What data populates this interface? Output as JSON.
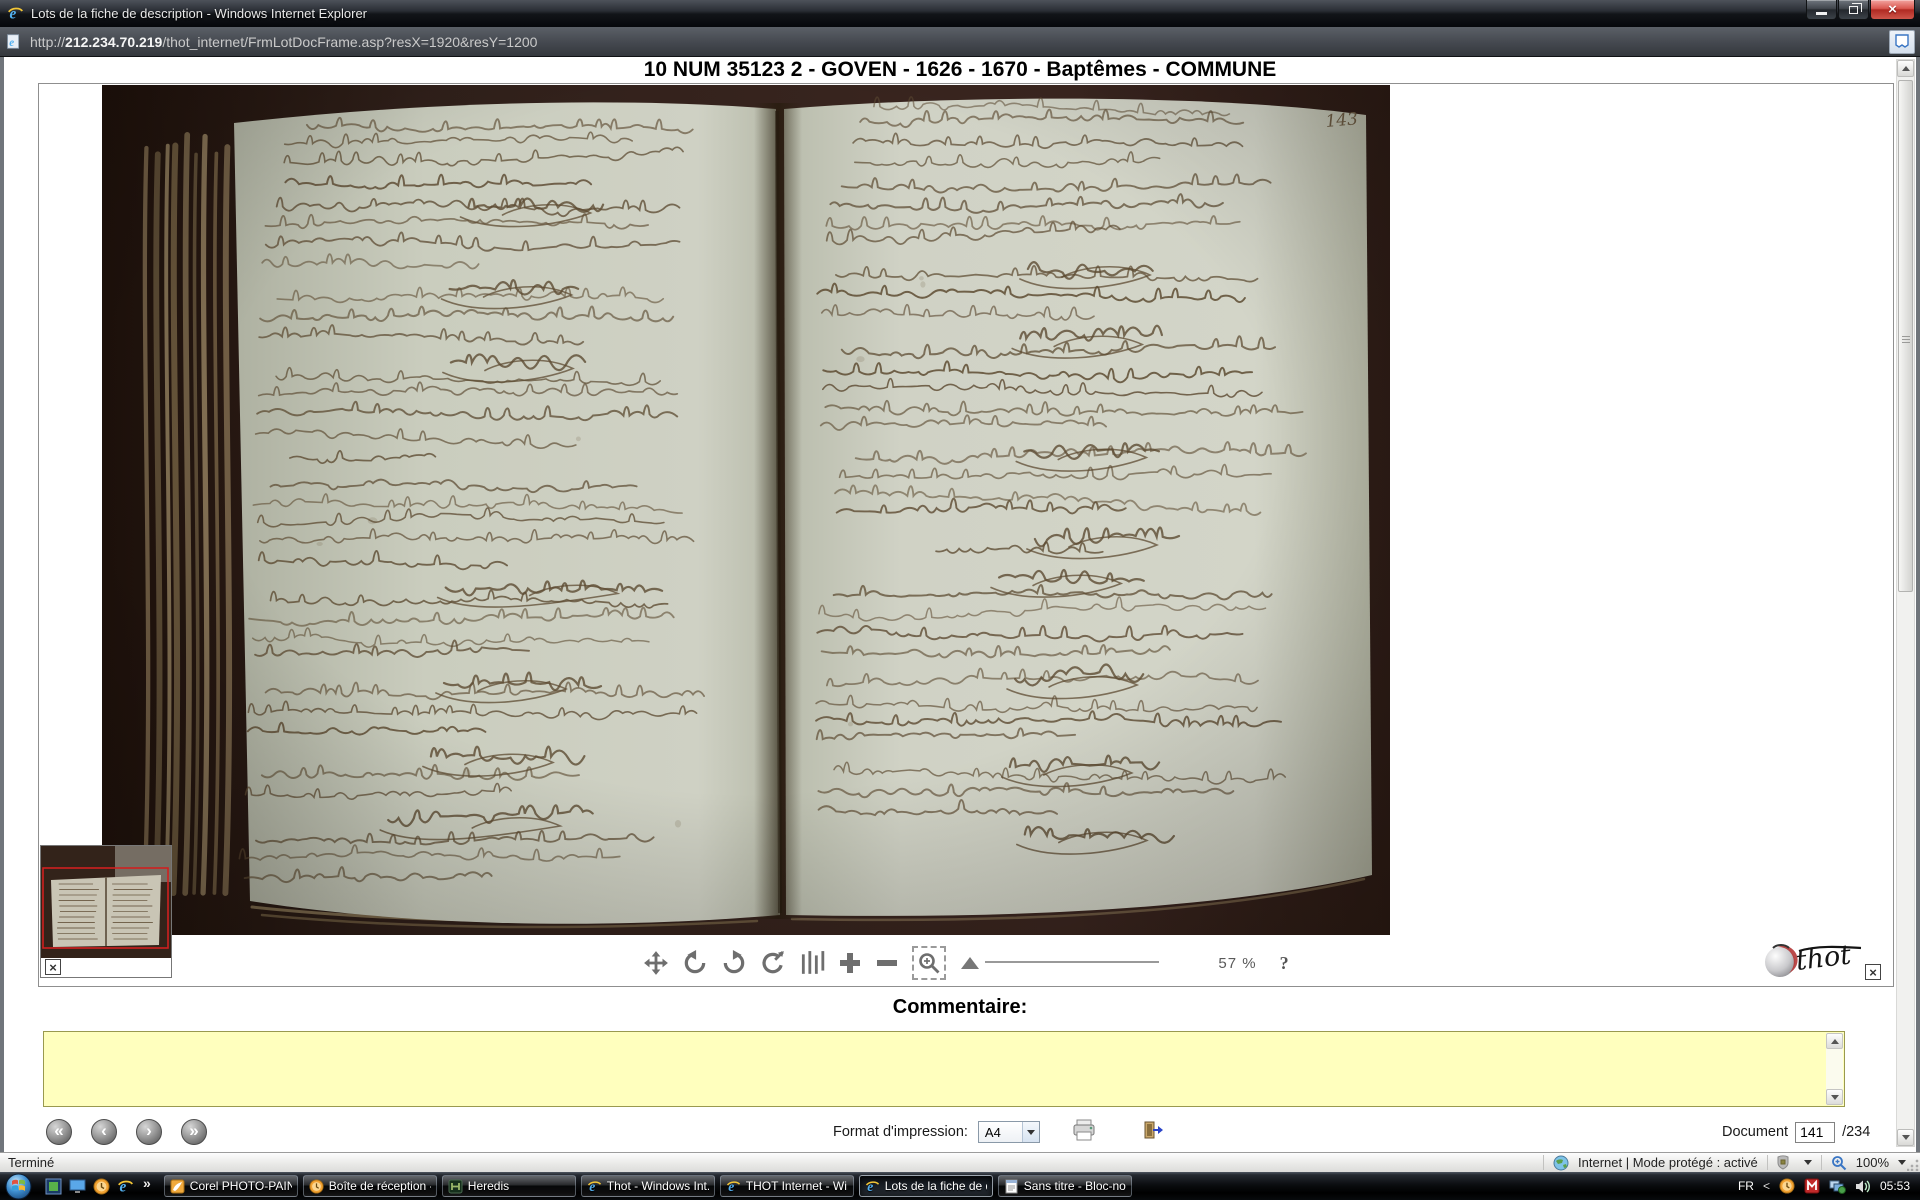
{
  "window": {
    "title": "Lots de la fiche de description - Windows Internet Explorer",
    "url_protocol": "http://",
    "url_host": "212.234.70.219",
    "url_path": "/thot_internet/FrmLotDocFrame.asp?resX=1920&resY=1200"
  },
  "header": {
    "title": "10 NUM 35123 2 - GOVEN - 1626 - 1670 - Baptêmes - COMMUNE"
  },
  "manuscript": {
    "page_number": "143"
  },
  "toolbar": {
    "zoom_level": "57 %",
    "help_label": "?",
    "icons": [
      "pan",
      "rotate-left",
      "rotate-right",
      "rotate-reset",
      "adjust-levels",
      "zoom-in",
      "zoom-out",
      "zoom-select",
      "zoom-slider"
    ]
  },
  "logo": {
    "brand": "thot",
    "close_label": "×"
  },
  "thumbnail": {
    "close_label": "×"
  },
  "comment": {
    "label": "Commentaire:",
    "value": ""
  },
  "footer": {
    "nav_first": "«",
    "nav_prev": "‹",
    "nav_next": "›",
    "nav_last": "»",
    "print_label": "Format d'impression:",
    "print_format": "A4",
    "document_label": "Document",
    "document_number": "141",
    "document_total": "/234"
  },
  "status": {
    "left": "Terminé",
    "zone": "Internet | Mode protégé : activé",
    "browser_zoom": "100%"
  },
  "taskbar": {
    "items": [
      {
        "label": "Corel PHOTO-PAIN...",
        "icon": "corel-photo-paint"
      },
      {
        "label": "Boîte de réception - ...",
        "icon": "outlook"
      },
      {
        "label": "Heredis",
        "icon": "heredis"
      },
      {
        "label": "Thot - Windows Int...",
        "icon": "internet-explorer"
      },
      {
        "label": "THOT Internet - Wi...",
        "icon": "internet-explorer"
      },
      {
        "label": "Lots de la fiche de d...",
        "icon": "internet-explorer",
        "active": true
      },
      {
        "label": "Sans titre - Bloc-notes",
        "icon": "notepad"
      }
    ],
    "overflow_chevron": "»",
    "tray": {
      "language": "FR",
      "chevron": "<",
      "time": "05:53"
    }
  },
  "icons": {
    "ie_letter": "e"
  }
}
